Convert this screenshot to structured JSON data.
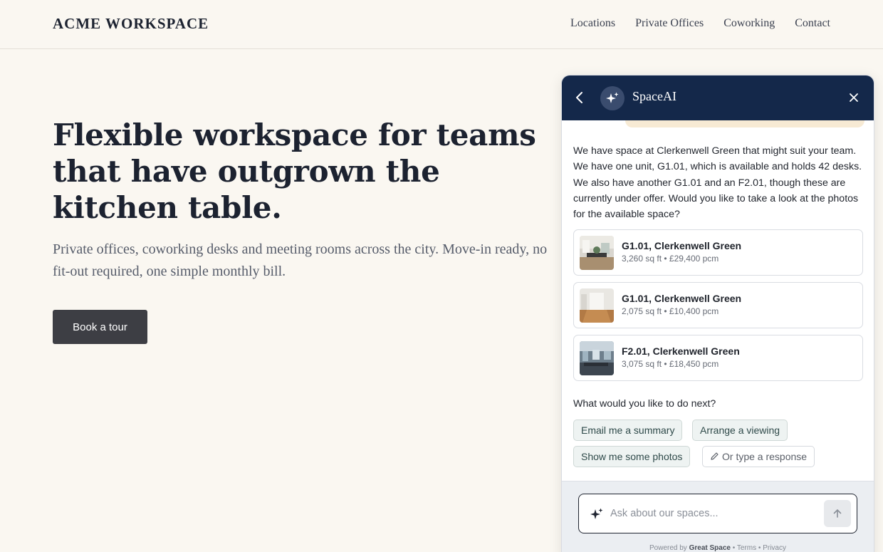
{
  "header": {
    "logo": "ACME WORKSPACE",
    "nav": [
      "Locations",
      "Private Offices",
      "Coworking",
      "Contact"
    ]
  },
  "hero": {
    "title": "Flexible workspace for teams that have outgrown the kitchen table.",
    "subtitle": "Private offices, coworking desks and meeting rooms across the city. Move-in ready, no fit-out required, one simple monthly bill.",
    "cta": "Book a tour"
  },
  "chat": {
    "title": "SpaceAI",
    "message": "We have space at Clerkenwell Green that might suit your team. We have one unit, G1.01, which is available and holds 42 desks. We also have another G1.01 and an F2.01, though these are currently under offer. Would you like to take a look at the photos for the available space?",
    "cards": [
      {
        "title": "G1.01, Clerkenwell Green",
        "meta": "3,260 sq ft • £29,400 pcm"
      },
      {
        "title": "G1.01, Clerkenwell Green",
        "meta": "2,075 sq ft • £10,400 pcm"
      },
      {
        "title": "F2.01, Clerkenwell Green",
        "meta": "3,075 sq ft • £18,450 pcm"
      }
    ],
    "next_question": "What would you like to do next?",
    "chips": {
      "email": "Email me a summary",
      "viewing": "Arrange a viewing",
      "photos": "Show me some photos",
      "type": "Or type a response"
    },
    "input_placeholder": "Ask about our spaces...",
    "footer": {
      "powered": "Powered by",
      "brand": "Great Space",
      "sep": "•",
      "terms": "Terms",
      "privacy": "Privacy"
    }
  },
  "colors": {
    "chat_header": "#14284a",
    "cta": "#3d3e44",
    "background": "#faf7f1"
  }
}
